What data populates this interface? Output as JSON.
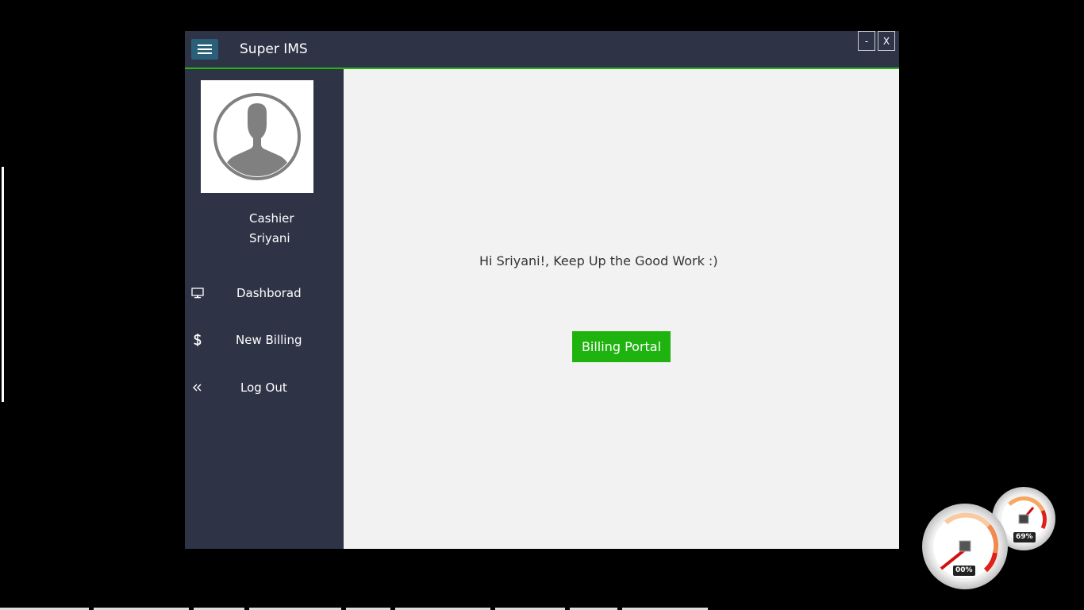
{
  "window": {
    "title": "Super IMS",
    "minimize_label": "-",
    "close_label": "X",
    "accent_color": "#22b614",
    "sidebar_color": "#2e3446"
  },
  "user": {
    "role": "Cashier",
    "name": "Sriyani",
    "avatar_icon": "user-silhouette-icon"
  },
  "sidebar": {
    "items": [
      {
        "label": "Dashborad",
        "icon": "monitor-icon"
      },
      {
        "label": "New Billing",
        "icon": "dollar-icon"
      },
      {
        "label": "Log Out",
        "icon": "double-chevron-left-icon"
      }
    ]
  },
  "main": {
    "greeting": "Hi Sriyani!, Keep Up the Good Work :)",
    "billing_button_label": "Billing Portal",
    "button_color": "#1fb30f"
  },
  "gadget": {
    "memory_readout": "69%",
    "cpu_readout": "00%"
  }
}
